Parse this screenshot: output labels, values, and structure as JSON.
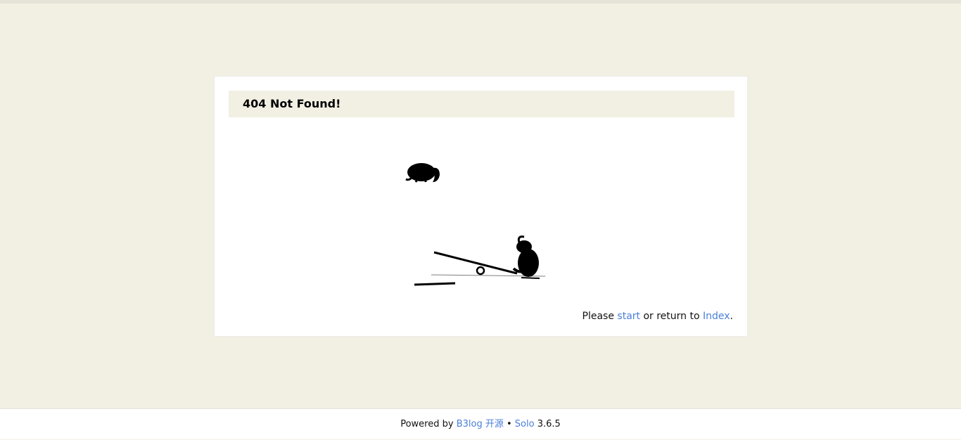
{
  "page": {
    "title": "404 Not Found!"
  },
  "hint": {
    "prefix": "Please ",
    "start_link": "start",
    "middle": " or return to ",
    "index_link": "Index",
    "suffix": "."
  },
  "footer": {
    "powered_by": "Powered by ",
    "b3log_link": "B3log 开源",
    "separator": " • ",
    "solo_link": "Solo",
    "version": " 3.6.5"
  },
  "colors": {
    "background": "#f2efe3",
    "link": "#4a7fd9",
    "card": "#ffffff"
  },
  "icons": {
    "illustration": "elephant-seesaw-illustration"
  }
}
